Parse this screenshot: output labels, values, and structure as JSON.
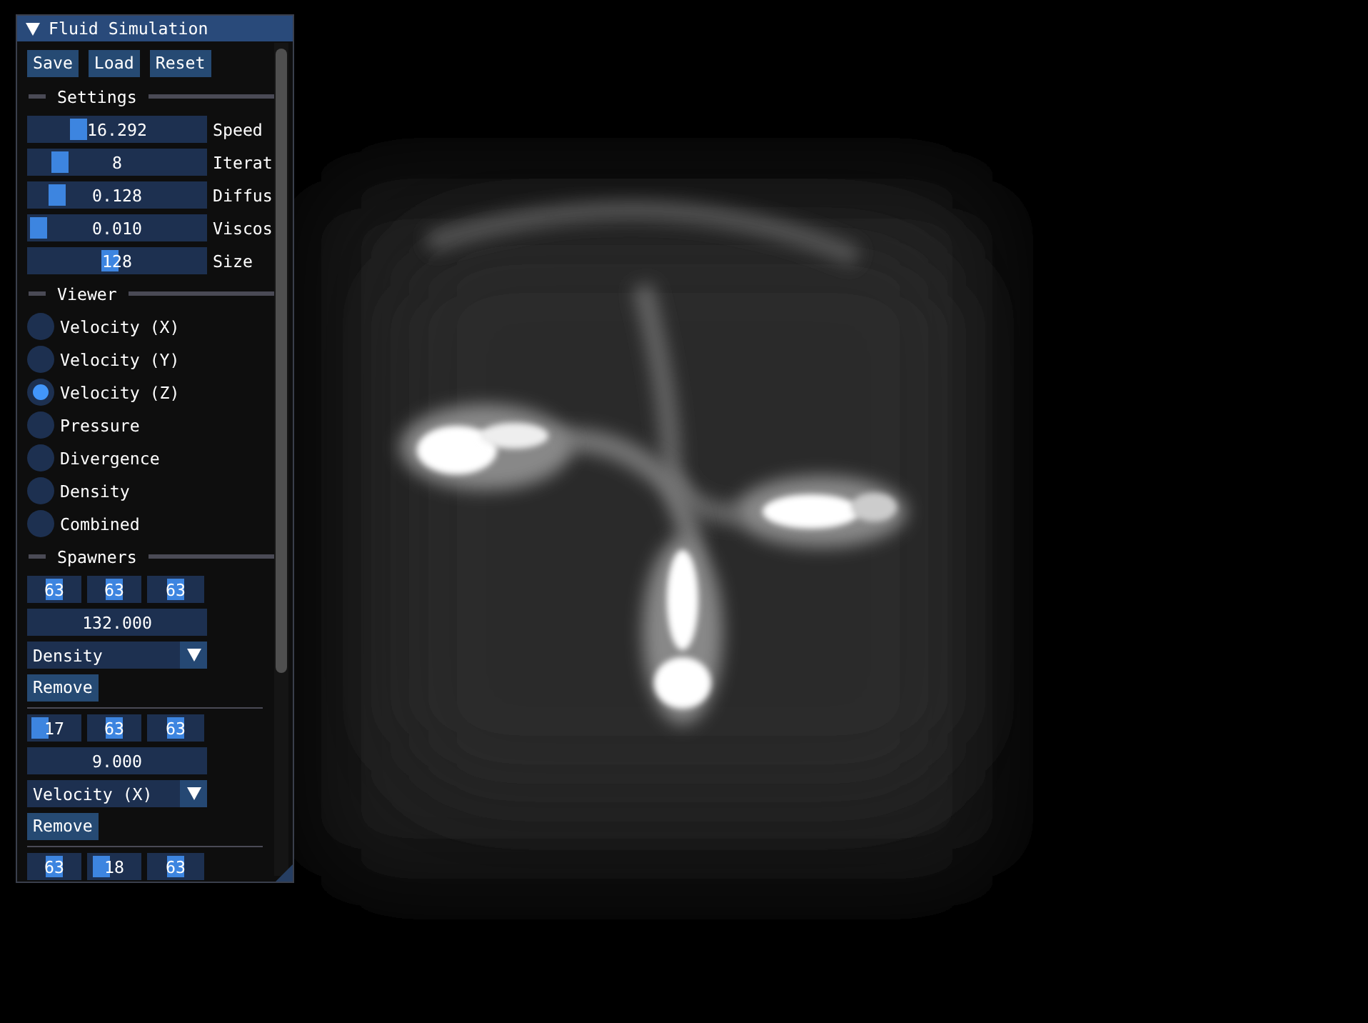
{
  "window": {
    "title": "Fluid Simulation",
    "collapsed": false
  },
  "buttons": [
    "Save",
    "Load",
    "Reset"
  ],
  "settings": {
    "label": "Settings",
    "sliders": [
      {
        "label": "Speed",
        "value": "16.292",
        "level": 0.26
      },
      {
        "label": "Iterat",
        "value": "8",
        "level": 0.15
      },
      {
        "label": "Diffus",
        "value": "0.128",
        "level": 0.13
      },
      {
        "label": "Viscos",
        "value": "0.010",
        "level": 0.02
      },
      {
        "label": "Size",
        "value": "128",
        "level": 0.46
      }
    ]
  },
  "viewer": {
    "label": "Viewer",
    "options": [
      {
        "label": "Velocity (X)",
        "selected": false
      },
      {
        "label": "Velocity (Y)",
        "selected": false
      },
      {
        "label": "Velocity (Z)",
        "selected": true
      },
      {
        "label": "Pressure",
        "selected": false
      },
      {
        "label": "Divergence",
        "selected": false
      },
      {
        "label": "Density",
        "selected": false
      },
      {
        "label": "Combined",
        "selected": false
      }
    ]
  },
  "spawners": {
    "label": "Spawners",
    "items": [
      {
        "coords": [
          {
            "value": "63",
            "level": 0.5
          },
          {
            "value": "63",
            "level": 0.5
          },
          {
            "value": "63",
            "level": 0.5
          }
        ],
        "amount": "132.000",
        "type": "Density",
        "remove": "Remove"
      },
      {
        "coords": [
          {
            "value": "17",
            "level": 0.13
          },
          {
            "value": "63",
            "level": 0.5
          },
          {
            "value": "63",
            "level": 0.5
          }
        ],
        "amount": "9.000",
        "type": "Velocity (X)",
        "remove": "Remove"
      },
      {
        "coords": [
          {
            "value": "63",
            "level": 0.5
          },
          {
            "value": "18",
            "level": 0.14
          },
          {
            "value": "63",
            "level": 0.5
          }
        ]
      }
    ]
  }
}
